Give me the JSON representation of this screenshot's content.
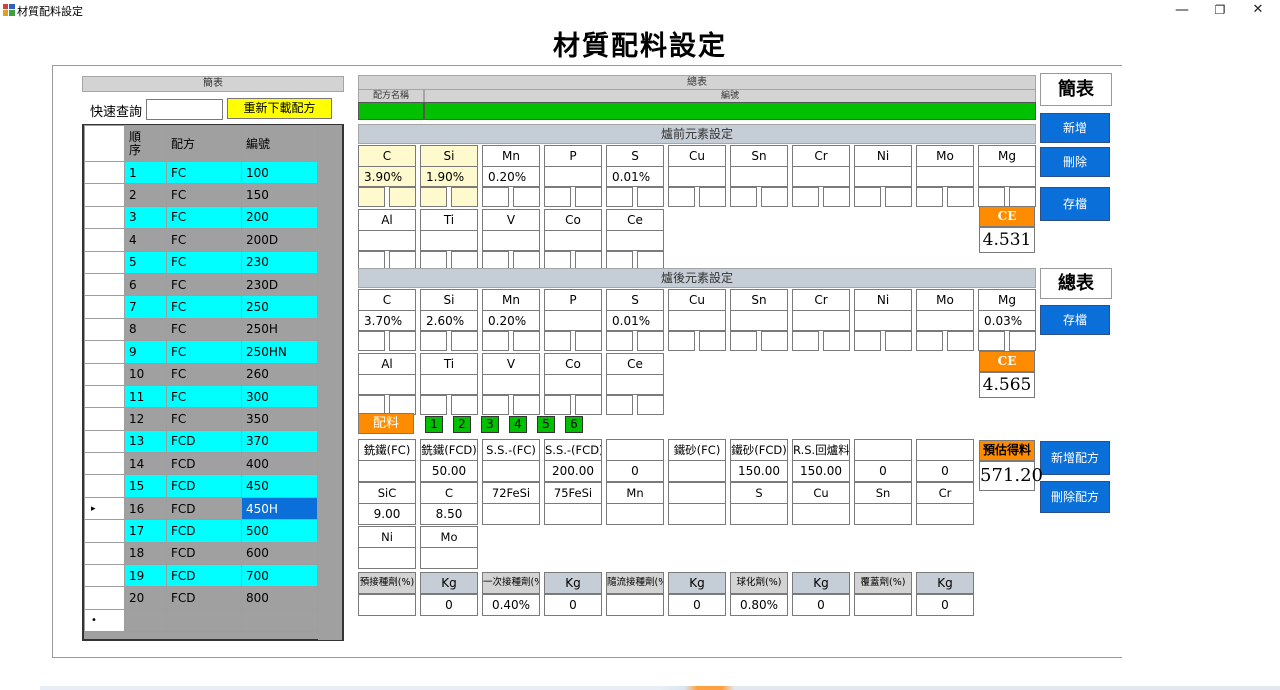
{
  "window": {
    "title": "材質配料設定",
    "minimize": "—",
    "restore": "❐",
    "close": "✕"
  },
  "page_title": "材質配料設定",
  "left": {
    "header": "簡表",
    "search_label": "快速查詢",
    "search_value": "",
    "reload_button": "重新下載配方",
    "columns": [
      "順\n序",
      "配方",
      "編號"
    ],
    "col_seq": "順序",
    "col_recipe": "配方",
    "col_number": "編號",
    "rows": [
      {
        "seq": "1",
        "recipe": "FC",
        "number": "100"
      },
      {
        "seq": "2",
        "recipe": "FC",
        "number": "150"
      },
      {
        "seq": "3",
        "recipe": "FC",
        "number": "200"
      },
      {
        "seq": "4",
        "recipe": "FC",
        "number": "200D"
      },
      {
        "seq": "5",
        "recipe": "FC",
        "number": "230"
      },
      {
        "seq": "6",
        "recipe": "FC",
        "number": "230D"
      },
      {
        "seq": "7",
        "recipe": "FC",
        "number": "250"
      },
      {
        "seq": "8",
        "recipe": "FC",
        "number": "250H"
      },
      {
        "seq": "9",
        "recipe": "FC",
        "number": "250HN"
      },
      {
        "seq": "10",
        "recipe": "FC",
        "number": "260"
      },
      {
        "seq": "11",
        "recipe": "FC",
        "number": "300"
      },
      {
        "seq": "12",
        "recipe": "FC",
        "number": "350"
      },
      {
        "seq": "13",
        "recipe": "FCD",
        "number": "370"
      },
      {
        "seq": "14",
        "recipe": "FCD",
        "number": "400"
      },
      {
        "seq": "15",
        "recipe": "FCD",
        "number": "450"
      },
      {
        "seq": "16",
        "recipe": "FCD",
        "number": "450H"
      },
      {
        "seq": "17",
        "recipe": "FCD",
        "number": "500"
      },
      {
        "seq": "18",
        "recipe": "FCD",
        "number": "600"
      },
      {
        "seq": "19",
        "recipe": "FCD",
        "number": "700"
      },
      {
        "seq": "20",
        "recipe": "FCD",
        "number": "800"
      }
    ],
    "current_row_marker": "▸",
    "new_row_marker": "•"
  },
  "summary": {
    "header": "總表",
    "col_name": "配方名稱",
    "col_number": "編號"
  },
  "pre": {
    "title": "爐前元素設定",
    "row1": [
      {
        "el": "C",
        "val": "3.90%"
      },
      {
        "el": "Si",
        "val": "1.90%"
      },
      {
        "el": "Mn",
        "val": "0.20%"
      },
      {
        "el": "P",
        "val": ""
      },
      {
        "el": "S",
        "val": "0.01%"
      },
      {
        "el": "Cu",
        "val": ""
      },
      {
        "el": "Sn",
        "val": ""
      },
      {
        "el": "Cr",
        "val": ""
      },
      {
        "el": "Ni",
        "val": ""
      },
      {
        "el": "Mo",
        "val": ""
      },
      {
        "el": "Mg",
        "val": ""
      }
    ],
    "row2": [
      {
        "el": "Al",
        "val": ""
      },
      {
        "el": "Ti",
        "val": ""
      },
      {
        "el": "V",
        "val": ""
      },
      {
        "el": "Co",
        "val": ""
      },
      {
        "el": "Ce",
        "val": ""
      }
    ],
    "ce_label": "CE",
    "ce_value": "4.531"
  },
  "post": {
    "title": "爐後元素設定",
    "row1": [
      {
        "el": "C",
        "val": "3.70%"
      },
      {
        "el": "Si",
        "val": "2.60%"
      },
      {
        "el": "Mn",
        "val": "0.20%"
      },
      {
        "el": "P",
        "val": ""
      },
      {
        "el": "S",
        "val": "0.01%"
      },
      {
        "el": "Cu",
        "val": ""
      },
      {
        "el": "Sn",
        "val": ""
      },
      {
        "el": "Cr",
        "val": ""
      },
      {
        "el": "Ni",
        "val": ""
      },
      {
        "el": "Mo",
        "val": ""
      },
      {
        "el": "Mg",
        "val": "0.03%"
      }
    ],
    "row2": [
      {
        "el": "Al",
        "val": ""
      },
      {
        "el": "Ti",
        "val": ""
      },
      {
        "el": "V",
        "val": ""
      },
      {
        "el": "Co",
        "val": ""
      },
      {
        "el": "Ce",
        "val": ""
      }
    ],
    "ce_label": "CE",
    "ce_value": "4.565"
  },
  "right_buttons": {
    "brief": "簡表",
    "add": "新增",
    "delete": "刪除",
    "save1": "存檔",
    "summary": "總表",
    "save2": "存檔",
    "add_recipe": "新增配方",
    "delete_recipe": "刪除配方"
  },
  "batch": {
    "label": "配料",
    "tabs": [
      "1",
      "2",
      "3",
      "4",
      "5",
      "6"
    ],
    "row1": [
      {
        "h": "銑鐵(FC)",
        "v": ""
      },
      {
        "h": "銑鐵(FCD)",
        "v": "50.00"
      },
      {
        "h": "S.S.-(FC)",
        "v": ""
      },
      {
        "h": "S.S.-(FCD)",
        "v": "200.00"
      },
      {
        "h": "",
        "v": "0"
      },
      {
        "h": "鐵砂(FC)",
        "v": ""
      },
      {
        "h": "鐵砂(FCD)",
        "v": "150.00"
      },
      {
        "h": "R.S.回爐料",
        "v": "150.00"
      },
      {
        "h": "",
        "v": "0"
      },
      {
        "h": "",
        "v": "0"
      }
    ],
    "row2": [
      {
        "h": "SiC",
        "v": "9.00"
      },
      {
        "h": "C",
        "v": "8.50"
      },
      {
        "h": "72FeSi",
        "v": ""
      },
      {
        "h": "75FeSi",
        "v": ""
      },
      {
        "h": "Mn",
        "v": ""
      },
      {
        "h": "",
        "v": ""
      },
      {
        "h": "S",
        "v": ""
      },
      {
        "h": "Cu",
        "v": ""
      },
      {
        "h": "Sn",
        "v": ""
      },
      {
        "h": "Cr",
        "v": ""
      }
    ],
    "row3": [
      {
        "h": "Ni",
        "v": ""
      },
      {
        "h": "Mo",
        "v": ""
      }
    ],
    "estimate_label": "預估得料",
    "estimate_value": "571.20",
    "row4": [
      {
        "h": "預接種劑(%)",
        "v": ""
      },
      {
        "h": "Kg",
        "v": "0"
      },
      {
        "h": "一次接種劑(%",
        "v": "0.40%"
      },
      {
        "h": "Kg",
        "v": "0"
      },
      {
        "h": "隨流接種劑(%",
        "v": ""
      },
      {
        "h": "Kg",
        "v": "0"
      },
      {
        "h": "球化劑(%)",
        "v": "0.80%"
      },
      {
        "h": "Kg",
        "v": "0"
      },
      {
        "h": "覆蓋劑(%)",
        "v": ""
      },
      {
        "h": "Kg",
        "v": "0"
      }
    ]
  },
  "colors": {
    "cyan": "#00ffff",
    "green": "#00c000",
    "orange": "#ff8c00",
    "blue": "#0a6fd8",
    "yellow": "#ffff00",
    "cream": "#fffacd"
  }
}
